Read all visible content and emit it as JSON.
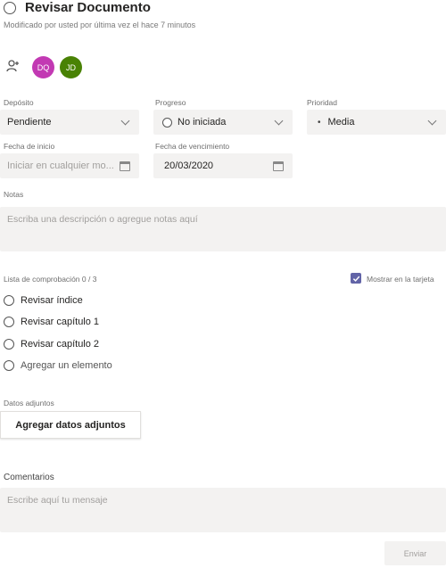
{
  "task": {
    "title": "Revisar Documento",
    "modified": "Modificado por usted por última vez el hace 7 minutos"
  },
  "assignees": [
    {
      "initials": "DQ",
      "color": "#c239b3"
    },
    {
      "initials": "JD",
      "color": "#498205"
    }
  ],
  "fields": {
    "bucket": {
      "label": "Depósito",
      "value": "Pendiente"
    },
    "progress": {
      "label": "Progreso",
      "value": "No iniciada"
    },
    "priority": {
      "label": "Prioridad",
      "value": "Media"
    },
    "start_date": {
      "label": "Fecha de inicio",
      "placeholder": "Iniciar en cualquier mo..."
    },
    "due_date": {
      "label": "Fecha de vencimiento",
      "value": "20/03/2020"
    }
  },
  "notes": {
    "label": "Notas",
    "placeholder": "Escriba una descripción o agregue notas aquí"
  },
  "checklist": {
    "label": "Lista de comprobación 0 / 3",
    "show_on_card": "Mostrar en la tarjeta",
    "items": [
      "Revisar índice",
      "Revisar capítulo 1",
      "Revisar capítulo 2"
    ],
    "add_item": "Agregar un elemento"
  },
  "attachments": {
    "label": "Datos adjuntos",
    "button": "Agregar datos adjuntos"
  },
  "comments": {
    "label": "Comentarios",
    "placeholder": "Escribe aquí tu mensaje",
    "send": "Enviar"
  },
  "colors": {
    "accent": "#6264a7",
    "field_bg": "#f3f2f1"
  }
}
